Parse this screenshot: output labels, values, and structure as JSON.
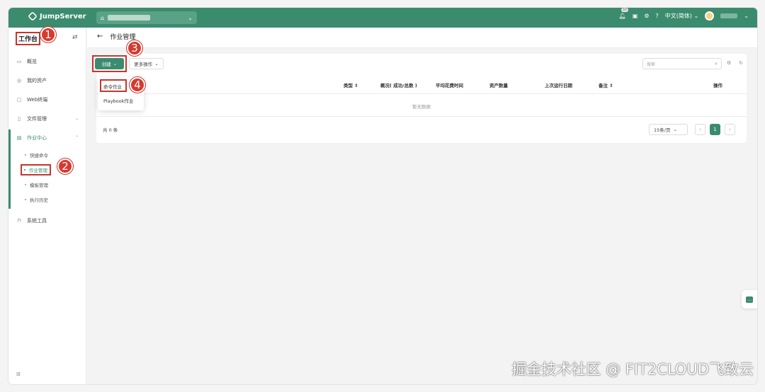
{
  "header": {
    "brand": "JumpServer",
    "org_chevron": "⌄",
    "notification_count": "30",
    "language": "中文(简体)"
  },
  "sidebar": {
    "workspace_title": "工作台",
    "swap_icon": "⇄",
    "items": [
      {
        "icon": "overview-icon",
        "label": "概览"
      },
      {
        "icon": "assets-icon",
        "label": "我的资产"
      },
      {
        "icon": "terminal-icon",
        "label": "Web终端"
      },
      {
        "icon": "file-icon",
        "label": "文件管理"
      },
      {
        "icon": "job-icon",
        "label": "作业中心"
      },
      {
        "icon": "tools-icon",
        "label": "系统工具"
      }
    ],
    "job_center_sub": [
      {
        "label": "快捷命令"
      },
      {
        "label": "作业管理"
      },
      {
        "label": "模板管理"
      },
      {
        "label": "执行历史"
      }
    ],
    "footer_icon": "menu-collapse-icon"
  },
  "page": {
    "back_arrow": "←",
    "title": "作业管理"
  },
  "toolbar": {
    "create_label": "创建",
    "more_actions_label": "更多操作",
    "search_placeholder": "搜索"
  },
  "dropdown": {
    "items": [
      {
        "label": "命令作业"
      },
      {
        "label": "Playbook作业"
      }
    ]
  },
  "table": {
    "columns": [
      {
        "label": "类型 ⇕"
      },
      {
        "label": "概况( 成功/总数 )"
      },
      {
        "label": "平均花费时间"
      },
      {
        "label": "资产数量"
      },
      {
        "label": "上次运行日期"
      },
      {
        "label": "备注 ⇕"
      },
      {
        "label": "操作"
      }
    ],
    "empty_text": "暂无数据"
  },
  "pagination": {
    "total_text": "共 0 条",
    "page_size": "15条/页",
    "prev": "‹",
    "current_page": "1",
    "next": "›"
  },
  "annotations": [
    "1",
    "2",
    "3",
    "4"
  ],
  "watermark": "掘金技术社区 @ FIT2CLOUD飞致云",
  "colors": {
    "primary": "#3b8b6f",
    "annotation": "#d63a2f"
  }
}
